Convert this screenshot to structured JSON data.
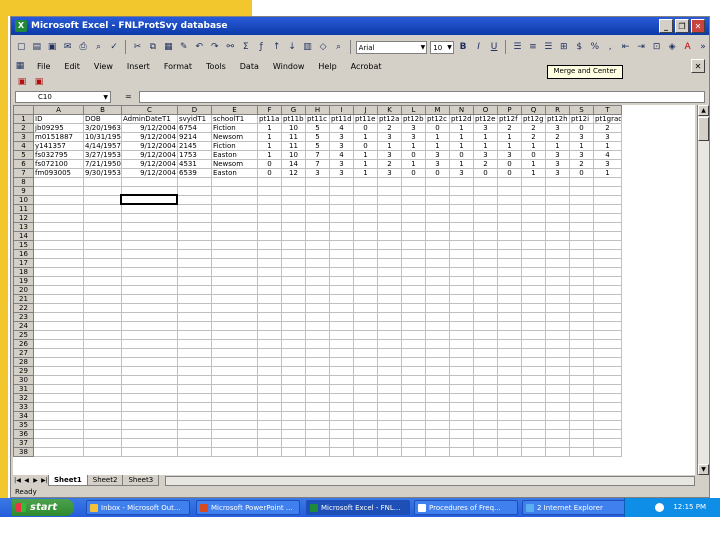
{
  "window": {
    "title": "Microsoft Excel - FNLProtSvy database",
    "controls": [
      "_",
      "❐",
      "✕"
    ],
    "close_doc": "✕"
  },
  "toolbar": {
    "font_name": "Arial",
    "font_size": "10",
    "bold": "B",
    "italic": "I",
    "underline": "U",
    "font_color": "A"
  },
  "menu": [
    "File",
    "Edit",
    "View",
    "Insert",
    "Format",
    "Tools",
    "Data",
    "Window",
    "Help",
    "Acrobat"
  ],
  "tooltip": "Merge and Center",
  "formula_bar": {
    "name_box": "C10",
    "fx": "=",
    "value": ""
  },
  "sheet": {
    "columns": [
      "A",
      "B",
      "C",
      "D",
      "E",
      "F",
      "G",
      "H",
      "I",
      "J",
      "K",
      "L",
      "M",
      "N",
      "O",
      "P",
      "Q",
      "R",
      "S",
      "T"
    ],
    "header_row": [
      "ID",
      "DOB",
      "AdminDateT1",
      "svyidT1",
      "schoolT1",
      "pt11a",
      "pt11b",
      "pt11c",
      "pt11d",
      "pt11e",
      "pt12a",
      "pt12b",
      "pt12c",
      "pt12d",
      "pt12e",
      "pt12f",
      "pt12g",
      "pt12h",
      "pt12i",
      "pt1grade"
    ],
    "rows": [
      [
        "jb09295",
        "3/20/1963",
        "9/12/2004",
        "6754",
        "Fiction",
        "1",
        "10",
        "5",
        "4",
        "0",
        "2",
        "3",
        "0",
        "1",
        "3",
        "2",
        "2",
        "3",
        "0",
        "2"
      ],
      [
        "m0151887",
        "10/31/1957",
        "9/12/2004",
        "9214",
        "Newsom",
        "1",
        "11",
        "5",
        "3",
        "1",
        "3",
        "3",
        "1",
        "1",
        "1",
        "1",
        "2",
        "2",
        "3",
        "3"
      ],
      [
        "y141357",
        "4/14/1957",
        "9/12/2004",
        "2145",
        "Fiction",
        "1",
        "11",
        "5",
        "3",
        "0",
        "1",
        "1",
        "1",
        "1",
        "1",
        "1",
        "1",
        "1",
        "1",
        "1"
      ],
      [
        "fs032795",
        "3/27/1953",
        "9/12/2004",
        "1753",
        "Easton",
        "1",
        "10",
        "7",
        "4",
        "1",
        "3",
        "0",
        "3",
        "0",
        "3",
        "3",
        "0",
        "3",
        "3",
        "4"
      ],
      [
        "fs072100",
        "7/21/1950",
        "9/12/2004",
        "4531",
        "Newsom",
        "0",
        "14",
        "7",
        "3",
        "1",
        "2",
        "1",
        "3",
        "1",
        "2",
        "0",
        "1",
        "3",
        "2",
        "3"
      ],
      [
        "fm093005",
        "9/30/1953",
        "9/12/2004",
        "6539",
        "Easton",
        "0",
        "12",
        "3",
        "3",
        "1",
        "3",
        "0",
        "0",
        "3",
        "0",
        "0",
        "1",
        "3",
        "0",
        "1"
      ]
    ],
    "row_numbers": [
      "1",
      "2",
      "3",
      "4",
      "5",
      "6",
      "7",
      "8",
      "9",
      "10",
      "11",
      "12",
      "13",
      "14",
      "15",
      "16",
      "17",
      "18",
      "19",
      "20",
      "21",
      "22",
      "23",
      "24",
      "25",
      "26",
      "27",
      "28",
      "29",
      "30",
      "31",
      "32",
      "33",
      "34",
      "35",
      "36",
      "37",
      "38"
    ],
    "selected_cell": "C10",
    "tabs": [
      "Sheet1",
      "Sheet2",
      "Sheet3"
    ],
    "active_tab": "Sheet1"
  },
  "status": "Ready",
  "taskbar": {
    "start": "start",
    "tasks": [
      {
        "label": "Inbox - Microsoft Out...",
        "color": "#f3c23a"
      },
      {
        "label": "Microsoft PowerPoint ...",
        "color": "#d64a1e"
      },
      {
        "label": "Microsoft Excel - FNL...",
        "color": "#1f8a3a"
      },
      {
        "label": "Procedures of Freq...",
        "color": "#ffffff"
      },
      {
        "label": "2 Internet Explorer",
        "color": "#5ab0f0"
      }
    ],
    "clock": "12:15 PM"
  }
}
